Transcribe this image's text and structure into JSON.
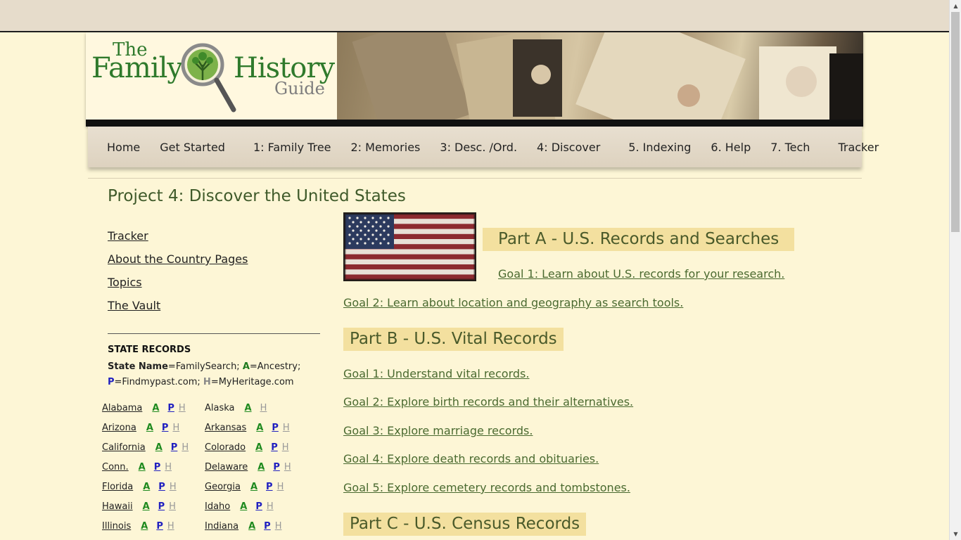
{
  "logo": {
    "the": "The",
    "family": "Family",
    "history": "History",
    "guide": "Guide"
  },
  "nav": {
    "items": [
      "Home",
      "Get Started",
      "1: Family Tree",
      "2: Memories",
      "3: Desc. /Ord.",
      "4: Discover",
      "5. Indexing",
      "6. Help",
      "7. Tech",
      "Tracker"
    ]
  },
  "page": {
    "title": "Project 4: Discover the United States"
  },
  "sidebar": {
    "links": [
      "Tracker",
      "About the Country Pages",
      "Topics",
      "The Vault"
    ],
    "state_records_heading": "STATE RECORDS",
    "legend": {
      "state_name": "State Name",
      "fs": "=FamilySearch; ",
      "a": "A",
      "ancestry": "=Ancestry;",
      "p": "P",
      "findmypast": "=Findmypast.com; ",
      "h": "H",
      "myheritage": "=MyHeritage.com"
    },
    "states": [
      {
        "left": {
          "name": "Alabama",
          "a": "A",
          "p": "P",
          "h": "H"
        },
        "right": {
          "name": "Alaska",
          "a": "A",
          "p": "",
          "h": "H"
        }
      },
      {
        "left": {
          "name": "Arizona",
          "a": "A",
          "p": "P",
          "h": "H"
        },
        "right": {
          "name": "Arkansas",
          "a": "A",
          "p": "P",
          "h": "H"
        }
      },
      {
        "left": {
          "name": "California",
          "a": "A",
          "p": "P",
          "h": "H"
        },
        "right": {
          "name": "Colorado",
          "a": "A",
          "p": "P",
          "h": "H"
        }
      },
      {
        "left": {
          "name": "Conn.",
          "a": "A",
          "p": "P",
          "h": "H"
        },
        "right": {
          "name": "Delaware",
          "a": "A",
          "p": "P",
          "h": "H"
        }
      },
      {
        "left": {
          "name": "Florida",
          "a": "A",
          "p": "P",
          "h": "H"
        },
        "right": {
          "name": "Georgia",
          "a": "A",
          "p": "P",
          "h": "H"
        }
      },
      {
        "left": {
          "name": "Hawaii",
          "a": "A",
          "p": "P",
          "h": "H"
        },
        "right": {
          "name": "Idaho",
          "a": "A",
          "p": "P",
          "h": "H"
        }
      },
      {
        "left": {
          "name": "Illinois",
          "a": "A",
          "p": "P",
          "h": "H"
        },
        "right": {
          "name": "Indiana",
          "a": "A",
          "p": "P",
          "h": "H"
        }
      }
    ]
  },
  "main": {
    "part_a": {
      "heading": "Part A - U.S. Records and Searches",
      "goals": [
        "Goal 1: Learn about U.S. records for your research.",
        "Goal 2: Learn about location and geography as search tools."
      ]
    },
    "part_b": {
      "heading": "Part B - U.S. Vital Records",
      "goals": [
        "Goal 1: Understand vital records.",
        "Goal 2: Explore birth records and their alternatives.",
        "Goal 3: Explore marriage records.",
        "Goal 4: Explore death records and obituaries.",
        "Goal 5: Explore cemetery records and tombstones."
      ]
    },
    "part_c": {
      "heading": "Part C - U.S. Census Records"
    }
  },
  "colors": {
    "background": "#fdf6d6",
    "heading_bg": "#f3e09f",
    "link_green": "#4a6a30",
    "ancestry_green": "#1f8a1f",
    "findmypast_blue": "#2020c0"
  }
}
